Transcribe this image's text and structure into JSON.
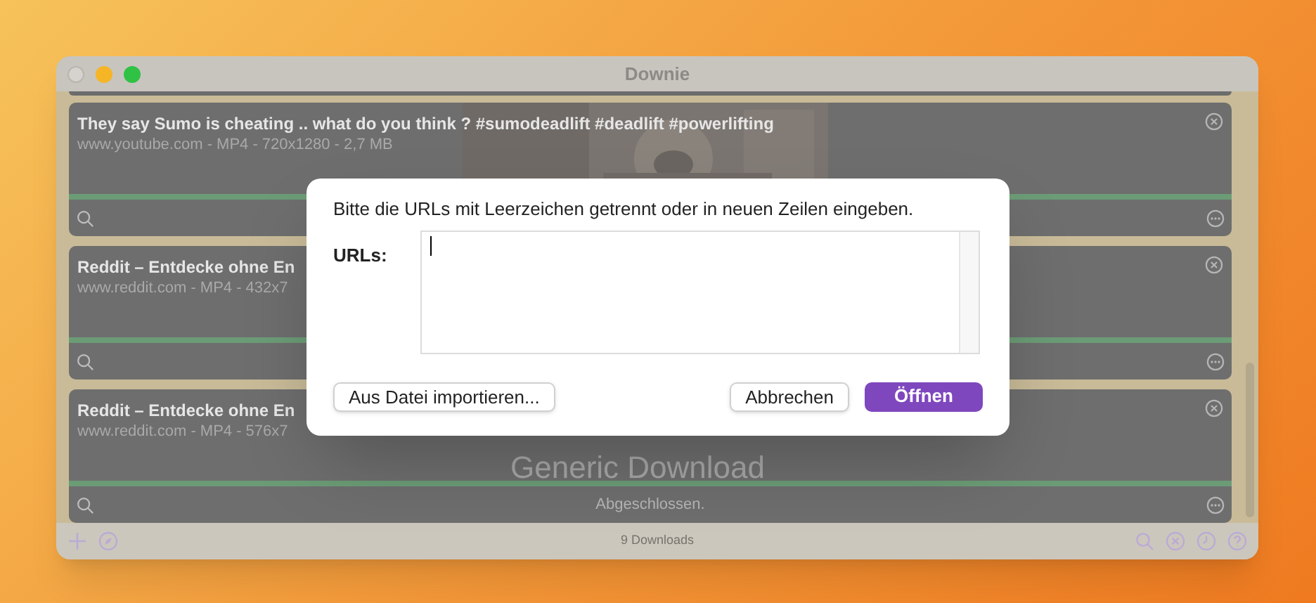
{
  "window": {
    "title": "Downie"
  },
  "downloads": [
    {
      "title": "They say Sumo is cheating .. what do you think ? #sumodeadlift #deadlift #powerlifting",
      "subtitle": "www.youtube.com - MP4 - 720x1280 - 2,7 MB",
      "level": 1
    },
    {
      "title": "Reddit – Entdecke ohne En",
      "subtitle": "www.reddit.com - MP4 - 432x7",
      "level": 1
    },
    {
      "title": "Reddit – Entdecke ohne En",
      "subtitle": "www.reddit.com - MP4 - 576x7",
      "level": 1,
      "placeholder_title": "Generic Download",
      "status": "Abgeschlossen."
    }
  ],
  "dialog": {
    "message": "Bitte die URLs mit Leerzeichen getrennt oder in neuen Zeilen eingeben.",
    "label": "URLs:",
    "import_button": "Aus Datei importieren...",
    "cancel_button": "Abbrechen",
    "open_button": "Öffnen"
  },
  "status_bar": {
    "count": "9 Downloads"
  }
}
